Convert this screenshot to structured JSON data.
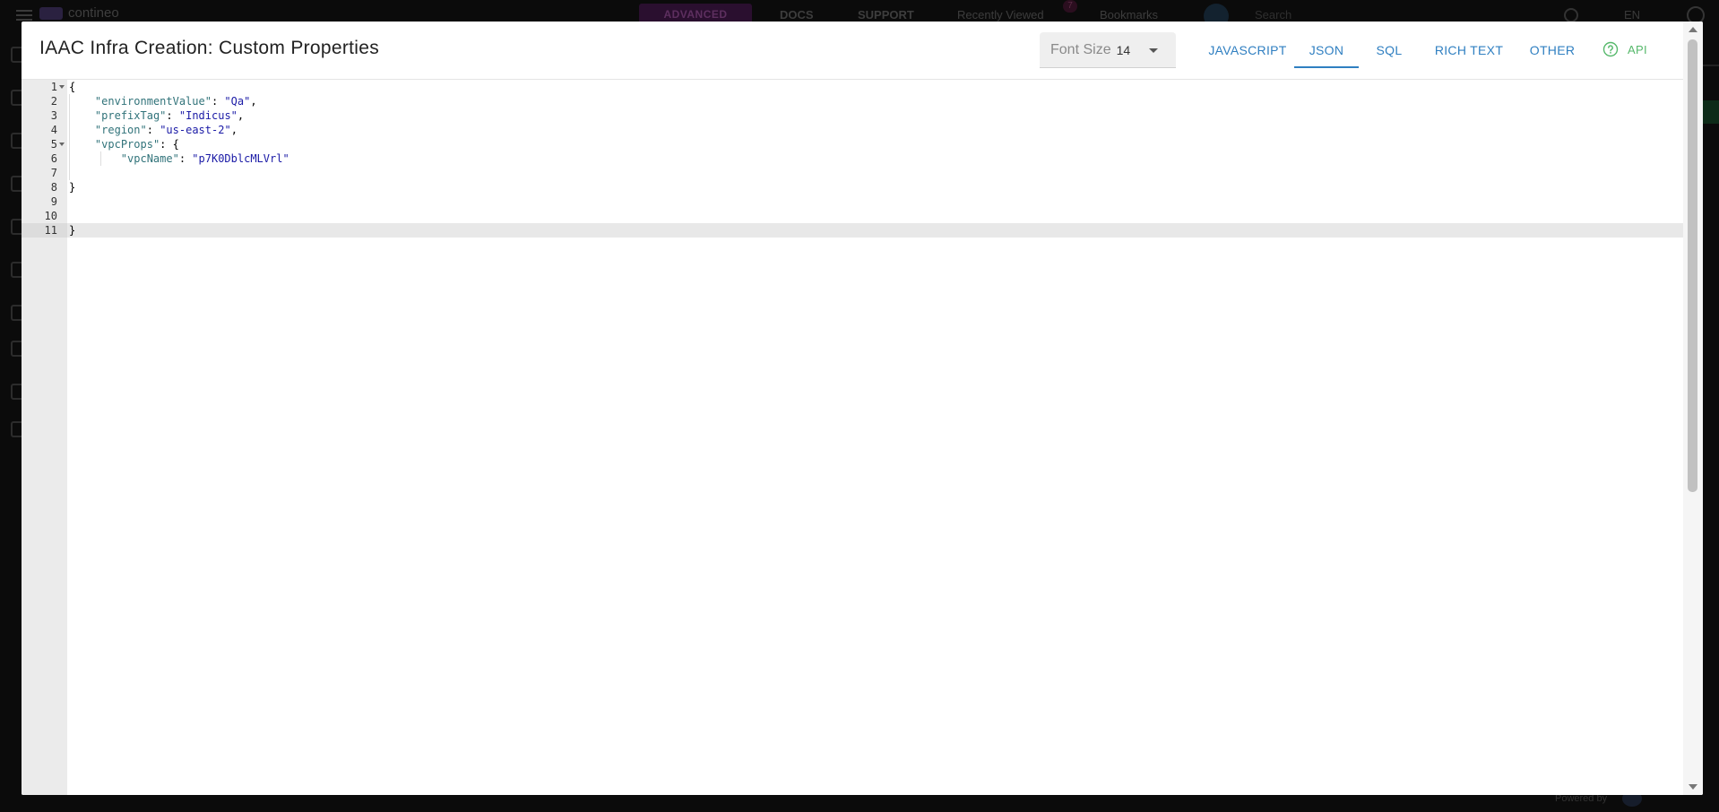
{
  "background": {
    "brand": "contineo",
    "mode_badge": "ADVANCED",
    "nav": {
      "docs": "DOCS",
      "support": "SUPPORT",
      "recently_viewed": "Recently Viewed",
      "recent_count": "7",
      "bookmarks": "Bookmarks"
    },
    "search_placeholder": "Search",
    "language": "EN",
    "powered_by": "Powered by"
  },
  "modal": {
    "title": "IAAC Infra Creation: Custom Properties",
    "font_size": {
      "label": "Font Size",
      "value": "14"
    },
    "tabs": [
      {
        "label": "JAVASCRIPT",
        "active": false
      },
      {
        "label": "JSON",
        "active": true
      },
      {
        "label": "SQL",
        "active": false
      },
      {
        "label": "RICH TEXT",
        "active": false
      },
      {
        "label": "OTHER",
        "active": false
      }
    ],
    "api_label": "API"
  },
  "editor": {
    "language": "JSON",
    "active_line": 11,
    "lines": [
      {
        "n": "1",
        "text": "{"
      },
      {
        "n": "2",
        "key": "environmentValue",
        "value": "Qa",
        "comma": ","
      },
      {
        "n": "3",
        "key": "prefixTag",
        "value": "Indicus",
        "comma": ","
      },
      {
        "n": "4",
        "key": "region",
        "value": "us-east-2",
        "comma": ","
      },
      {
        "n": "5",
        "key": "vpcProps",
        "open": "{"
      },
      {
        "n": "6",
        "key": "vpcName",
        "value": "p7K0DblcMLVrl"
      },
      {
        "n": "7",
        "text": ""
      },
      {
        "n": "8",
        "text": "}"
      },
      {
        "n": "9",
        "text": ""
      },
      {
        "n": "10",
        "text": ""
      },
      {
        "n": "11",
        "text": "}"
      }
    ]
  },
  "colors": {
    "tab_accent": "#2f7fc1",
    "api_accent": "#56b86b",
    "json_key": "#31737a",
    "json_string": "#1a1aa6"
  }
}
